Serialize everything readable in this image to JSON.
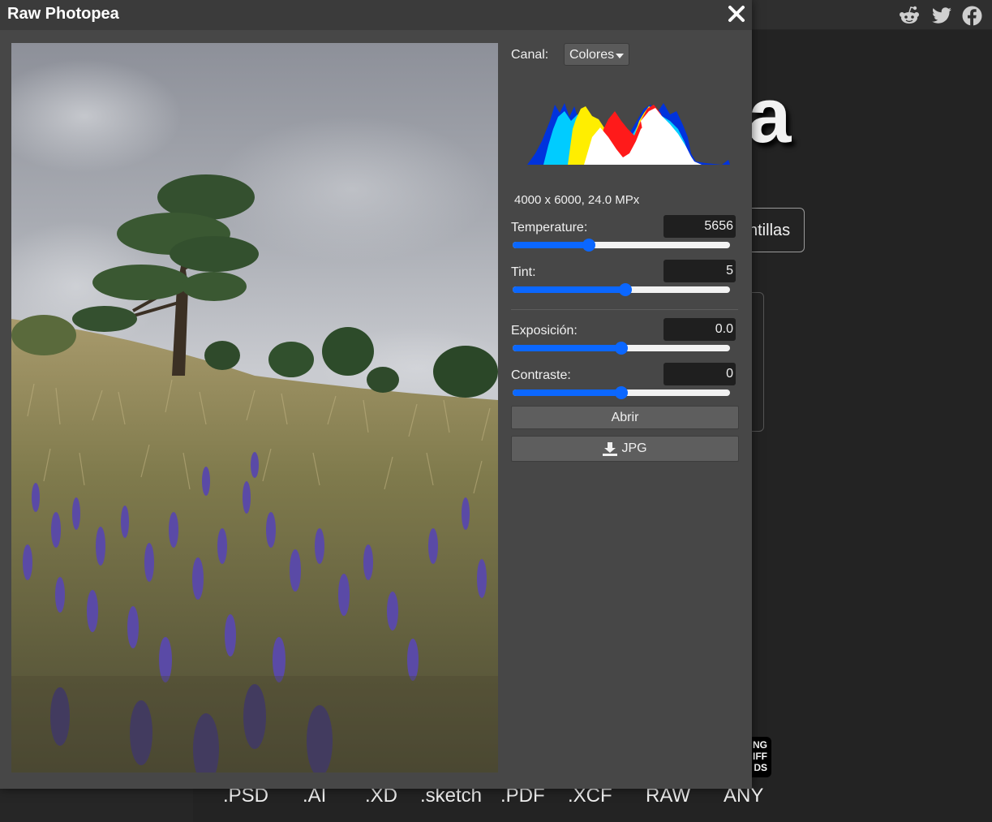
{
  "dialog": {
    "title": "Raw Photopea",
    "close_icon": "close-icon"
  },
  "controls": {
    "channel_label": "Canal:",
    "channel_value": "Colores",
    "image_info": "4000 x 6000, 24.0 MPx",
    "temperature": {
      "label": "Temperature:",
      "value": "5656",
      "position": 0.35
    },
    "tint": {
      "label": "Tint:",
      "value": "5",
      "position": 0.52
    },
    "exposure": {
      "label": "Exposición:",
      "value": "0.0",
      "position": 0.5
    },
    "contrast": {
      "label": "Contraste:",
      "value": "0",
      "position": 0.5
    },
    "open_button": "Abrir",
    "save_button": "JPG",
    "save_icon": "download-icon"
  },
  "background": {
    "logo_fragment": "a",
    "templates_fragment": "ntillas",
    "badge_lines": [
      "NG",
      "IFF",
      "DS"
    ],
    "formats": [
      ".PSD",
      ".AI",
      ".XD",
      ".sketch",
      ".PDF",
      ".XCF",
      "RAW",
      "ANY"
    ],
    "social_icons": [
      "reddit-icon",
      "twitter-icon",
      "facebook-icon"
    ]
  },
  "colors": {
    "accent": "#0b67ff",
    "dialog_bg": "#474747",
    "titlebar_bg": "#3b3b3b"
  }
}
